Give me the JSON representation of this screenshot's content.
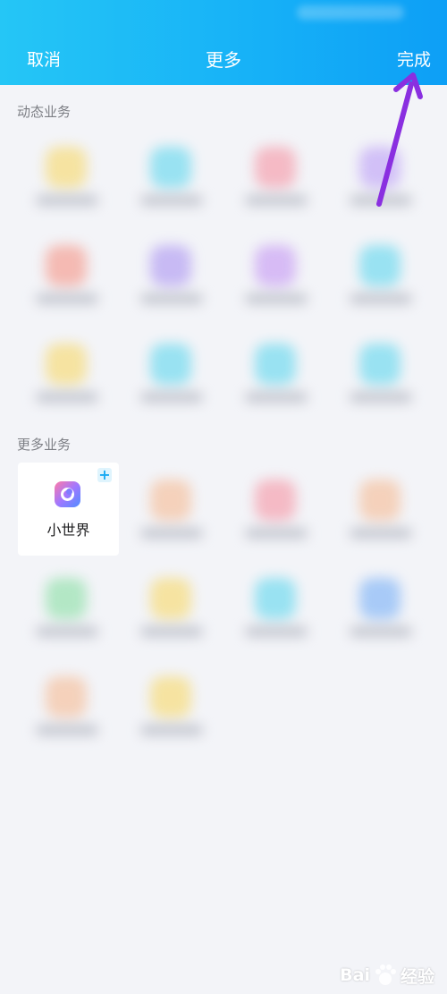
{
  "header": {
    "cancel_label": "取消",
    "title": "更多",
    "done_label": "完成"
  },
  "sections": {
    "dynamic_title": "动态业务",
    "more_title": "更多业务"
  },
  "dynamic_tiles": [
    {
      "color": "#f7d65a"
    },
    {
      "color": "#4fd4ec"
    },
    {
      "color": "#f58a9a"
    },
    {
      "color": "#b796f5"
    },
    {
      "color": "#f58a7a"
    },
    {
      "color": "#a48af0"
    },
    {
      "color": "#c08cf3"
    },
    {
      "color": "#4fd4ec"
    },
    {
      "color": "#f7d65a"
    },
    {
      "color": "#4fd4ec"
    },
    {
      "color": "#4fd4ec"
    },
    {
      "color": "#4fd4ec"
    }
  ],
  "more_tiles": [
    {
      "color": "#f6b488"
    },
    {
      "color": "#f58a9a"
    },
    {
      "color": "#f6b488"
    },
    {
      "color": "#7edd9a"
    },
    {
      "color": "#f7d65a"
    },
    {
      "color": "#4fd4ec"
    },
    {
      "color": "#6aa8f5"
    },
    {
      "color": "#f6b488"
    },
    {
      "color": "#f7d65a"
    }
  ],
  "featured_app": {
    "name": "小世界",
    "add_symbol": "+"
  },
  "watermark": {
    "text": "Bai",
    "suffix": "经验"
  },
  "colors": {
    "header_start": "#25c6f6",
    "header_end": "#0d9ff6",
    "arrow": "#8a2fe0",
    "page_bg": "#f3f4f8"
  }
}
